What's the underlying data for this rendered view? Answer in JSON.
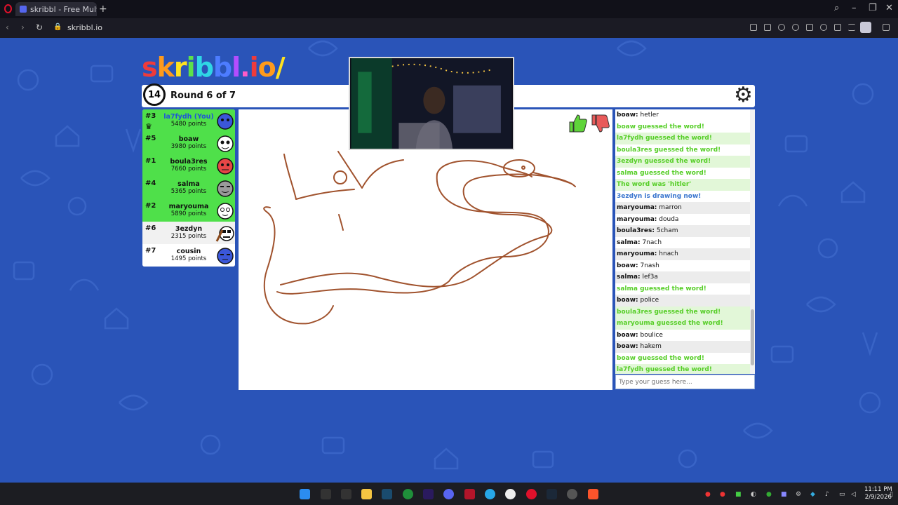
{
  "browser": {
    "tab_title": "skribbl - Free Multiplayer",
    "url": "skribbl.io"
  },
  "game": {
    "logo": "skribbl.io",
    "timer": "14",
    "round": "Round 6 of 7",
    "players": [
      {
        "rank": "#3",
        "name": "la7fydh (You)",
        "points": "5480 points",
        "you": true,
        "bg": "g",
        "avatar_color": "#3b57d9"
      },
      {
        "rank": "#5",
        "name": "boaw",
        "points": "3980 points",
        "bg": "g",
        "avatar_color": "#ffffff"
      },
      {
        "rank": "#1",
        "name": "boula3res",
        "points": "7660 points",
        "bg": "g",
        "avatar_color": "#e64646"
      },
      {
        "rank": "#4",
        "name": "salma",
        "points": "5365 points",
        "bg": "g",
        "avatar_color": "#9a9a9a"
      },
      {
        "rank": "#2",
        "name": "maryouma",
        "points": "5890 points",
        "bg": "g",
        "avatar_color": "#ffffff"
      },
      {
        "rank": "#6",
        "name": "3ezdyn",
        "points": "2315 points",
        "bg": "w",
        "avatar_color": "#ffffff"
      },
      {
        "rank": "#7",
        "name": "cousin",
        "points": "1495 points",
        "bg": "w2",
        "avatar_color": "#3b57d9"
      }
    ],
    "chat": [
      {
        "type": "msg",
        "user": "boaw:",
        "text": "hetler"
      },
      {
        "type": "good",
        "text": "boaw guessed the word!"
      },
      {
        "type": "goodalt",
        "text": "la7fydh guessed the word!"
      },
      {
        "type": "good",
        "text": "boula3res guessed the word!"
      },
      {
        "type": "goodalt",
        "text": "3ezdyn guessed the word!"
      },
      {
        "type": "good",
        "text": "salma guessed the word!"
      },
      {
        "type": "word",
        "text": "The word was 'hitler'"
      },
      {
        "type": "draw",
        "text": "3ezdyn is drawing now!"
      },
      {
        "type": "alt",
        "user": "maryouma:",
        "text": "marron"
      },
      {
        "type": "msg",
        "user": "maryouma:",
        "text": "douda"
      },
      {
        "type": "alt",
        "user": "boula3res:",
        "text": "5cham"
      },
      {
        "type": "msg",
        "user": "salma:",
        "text": "7nach"
      },
      {
        "type": "alt",
        "user": "maryouma:",
        "text": "hnach"
      },
      {
        "type": "msg",
        "user": "boaw:",
        "text": "7nash"
      },
      {
        "type": "alt",
        "user": "salma:",
        "text": "lef3a"
      },
      {
        "type": "good",
        "text": "salma guessed the word!"
      },
      {
        "type": "alt",
        "user": "boaw:",
        "text": "police"
      },
      {
        "type": "goodalt",
        "text": "boula3res guessed the word!"
      },
      {
        "type": "goodalt",
        "text": "maryouma guessed the word!"
      },
      {
        "type": "msg",
        "user": "boaw:",
        "text": "boulice"
      },
      {
        "type": "alt",
        "user": "boaw:",
        "text": "hakem"
      },
      {
        "type": "good",
        "text": "boaw guessed the word!"
      },
      {
        "type": "goodalt",
        "text": "la7fydh guessed the word!"
      }
    ],
    "guess_placeholder": "Type your guess here...",
    "colors": {
      "background": "#2a54b8",
      "guessed_green": "#56ce27",
      "drawing_blue": "#3975ce",
      "stroke": "#a0522d"
    }
  },
  "taskbar": {
    "time": "11:11 PM",
    "date": "2/9/2026"
  }
}
